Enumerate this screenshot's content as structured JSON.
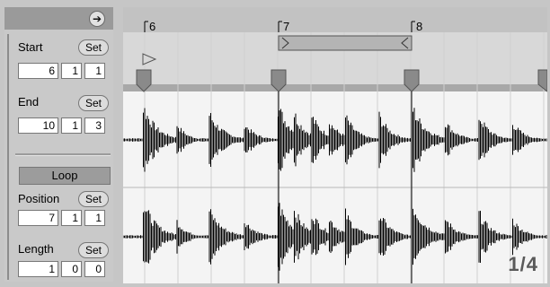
{
  "left_panel": {
    "start": {
      "label": "Start",
      "set": "Set",
      "values": [
        "6",
        "1",
        "1"
      ]
    },
    "end": {
      "label": "End",
      "set": "Set",
      "values": [
        "10",
        "1",
        "3"
      ]
    },
    "loop": {
      "label": "Loop"
    },
    "position": {
      "label": "Position",
      "set": "Set",
      "values": [
        "7",
        "1",
        "1"
      ]
    },
    "length": {
      "label": "Length",
      "set": "Set",
      "values": [
        "1",
        "0",
        "0"
      ]
    }
  },
  "ruler": {
    "bars": [
      "6",
      "7",
      "8"
    ]
  },
  "grid_scale": "1/4",
  "colors": {
    "panel_bg": "#c9c9c9",
    "waveform_bg": "#f4f4f4",
    "waveform": "#000000",
    "marker": "#8a8a8a",
    "loop_brace": "#b4b4b4"
  },
  "icons": {
    "header_button": "arrow-right-icon",
    "start_marker": "play-flag-icon"
  }
}
